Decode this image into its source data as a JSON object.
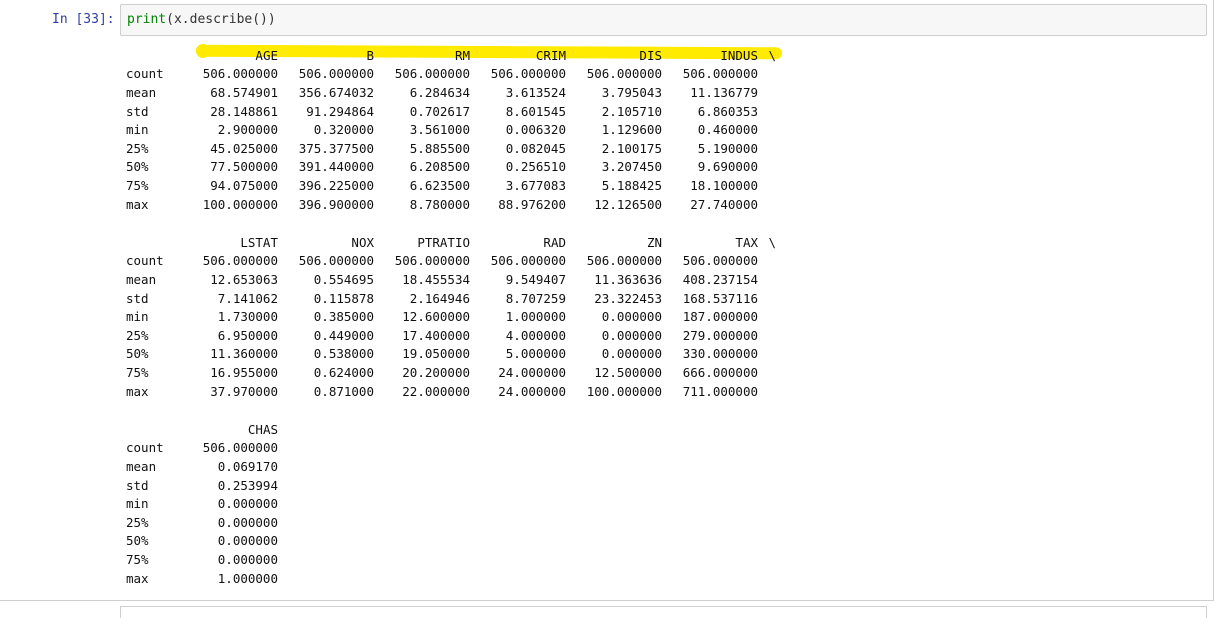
{
  "cell": {
    "prompt": "In [33]:",
    "code_func": "print",
    "code_rest": "(x.describe())"
  },
  "output": {
    "end_marker": "\\",
    "blocks": [
      {
        "columns": [
          "AGE",
          "B",
          "RM",
          "CRIM",
          "DIS",
          "INDUS"
        ],
        "has_end_marker": true,
        "rows": [
          {
            "label": "count",
            "values": [
              "506.000000",
              "506.000000",
              "506.000000",
              "506.000000",
              "506.000000",
              "506.000000"
            ]
          },
          {
            "label": "mean",
            "values": [
              "68.574901",
              "356.674032",
              "6.284634",
              "3.613524",
              "3.795043",
              "11.136779"
            ]
          },
          {
            "label": "std",
            "values": [
              "28.148861",
              "91.294864",
              "0.702617",
              "8.601545",
              "2.105710",
              "6.860353"
            ]
          },
          {
            "label": "min",
            "values": [
              "2.900000",
              "0.320000",
              "3.561000",
              "0.006320",
              "1.129600",
              "0.460000"
            ]
          },
          {
            "label": "25%",
            "values": [
              "45.025000",
              "375.377500",
              "5.885500",
              "0.082045",
              "2.100175",
              "5.190000"
            ]
          },
          {
            "label": "50%",
            "values": [
              "77.500000",
              "391.440000",
              "6.208500",
              "0.256510",
              "3.207450",
              "9.690000"
            ]
          },
          {
            "label": "75%",
            "values": [
              "94.075000",
              "396.225000",
              "6.623500",
              "3.677083",
              "5.188425",
              "18.100000"
            ]
          },
          {
            "label": "max",
            "values": [
              "100.000000",
              "396.900000",
              "8.780000",
              "88.976200",
              "12.126500",
              "27.740000"
            ]
          }
        ]
      },
      {
        "columns": [
          "LSTAT",
          "NOX",
          "PTRATIO",
          "RAD",
          "ZN",
          "TAX"
        ],
        "has_end_marker": true,
        "rows": [
          {
            "label": "count",
            "values": [
              "506.000000",
              "506.000000",
              "506.000000",
              "506.000000",
              "506.000000",
              "506.000000"
            ]
          },
          {
            "label": "mean",
            "values": [
              "12.653063",
              "0.554695",
              "18.455534",
              "9.549407",
              "11.363636",
              "408.237154"
            ]
          },
          {
            "label": "std",
            "values": [
              "7.141062",
              "0.115878",
              "2.164946",
              "8.707259",
              "23.322453",
              "168.537116"
            ]
          },
          {
            "label": "min",
            "values": [
              "1.730000",
              "0.385000",
              "12.600000",
              "1.000000",
              "0.000000",
              "187.000000"
            ]
          },
          {
            "label": "25%",
            "values": [
              "6.950000",
              "0.449000",
              "17.400000",
              "4.000000",
              "0.000000",
              "279.000000"
            ]
          },
          {
            "label": "50%",
            "values": [
              "11.360000",
              "0.538000",
              "19.050000",
              "5.000000",
              "0.000000",
              "330.000000"
            ]
          },
          {
            "label": "75%",
            "values": [
              "16.955000",
              "0.624000",
              "20.200000",
              "24.000000",
              "12.500000",
              "666.000000"
            ]
          },
          {
            "label": "max",
            "values": [
              "37.970000",
              "0.871000",
              "22.000000",
              "24.000000",
              "100.000000",
              "711.000000"
            ]
          }
        ]
      },
      {
        "columns": [
          "CHAS"
        ],
        "has_end_marker": false,
        "rows": [
          {
            "label": "count",
            "values": [
              "506.000000"
            ]
          },
          {
            "label": "mean",
            "values": [
              "0.069170"
            ]
          },
          {
            "label": "std",
            "values": [
              "0.253994"
            ]
          },
          {
            "label": "min",
            "values": [
              "0.000000"
            ]
          },
          {
            "label": "25%",
            "values": [
              "0.000000"
            ]
          },
          {
            "label": "50%",
            "values": [
              "0.000000"
            ]
          },
          {
            "label": "75%",
            "values": [
              "0.000000"
            ]
          },
          {
            "label": "max",
            "values": [
              "1.000000"
            ]
          }
        ]
      }
    ]
  },
  "colors": {
    "prompt": "#303f9f",
    "code_function": "#008000",
    "highlighter": "#ffeb00"
  }
}
